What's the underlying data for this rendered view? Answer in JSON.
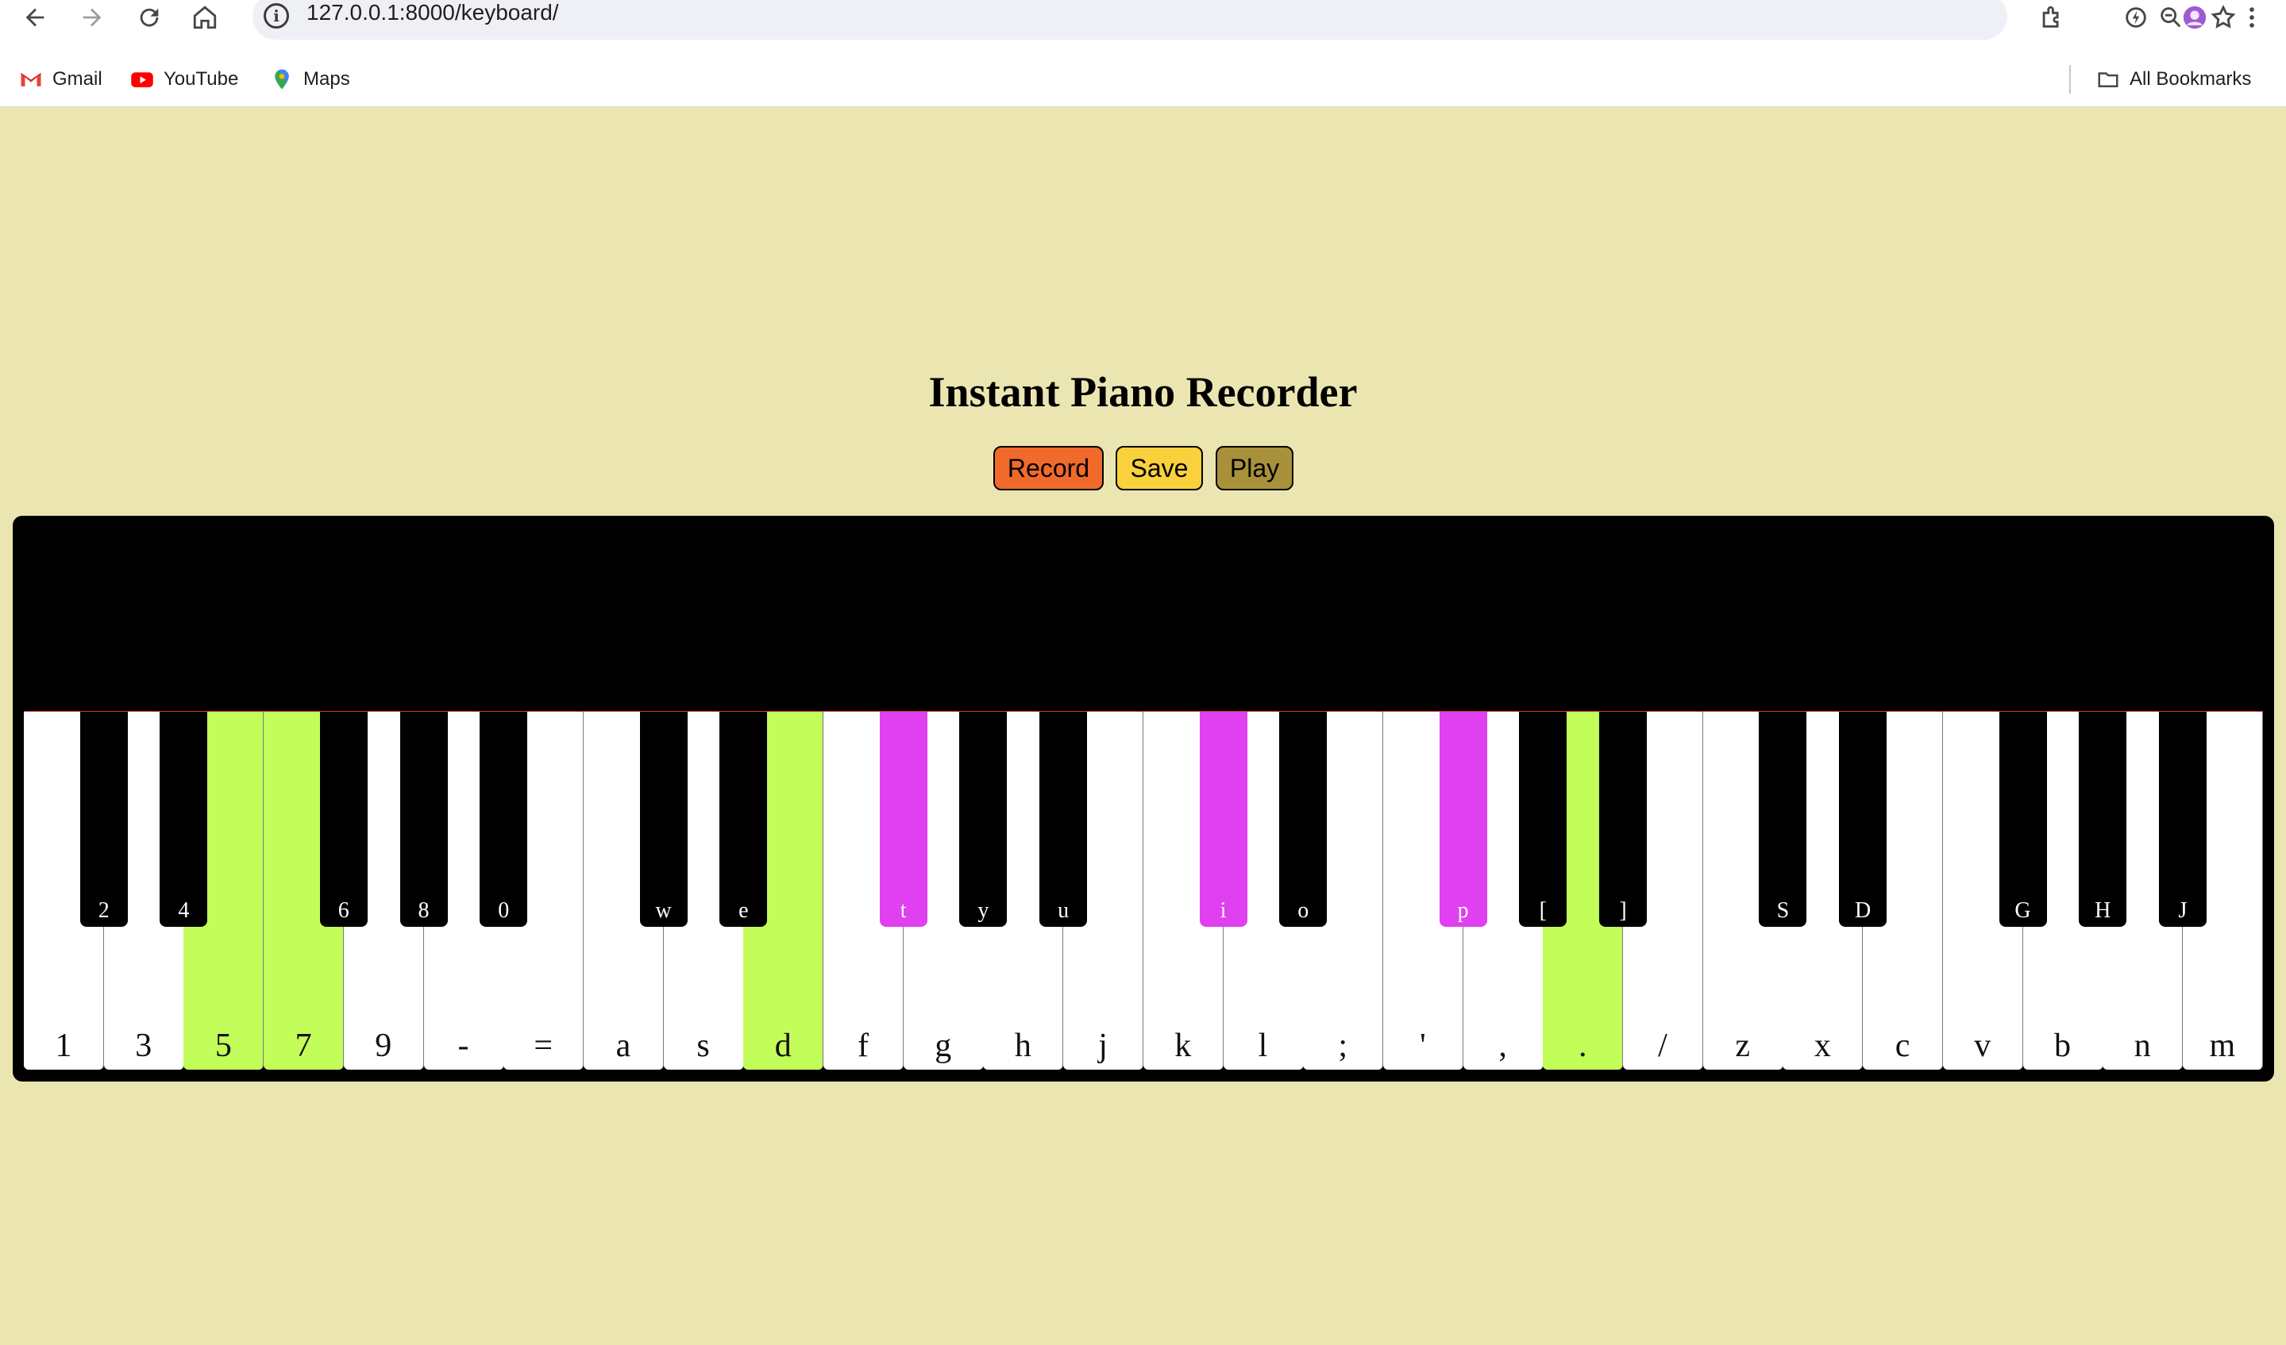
{
  "browser": {
    "url": "127.0.0.1:8000/keyboard/",
    "bookmarks": [
      "Gmail",
      "YouTube",
      "Maps"
    ],
    "all_bookmarks": "All Bookmarks"
  },
  "page": {
    "title": "Instant Piano Recorder",
    "buttons": {
      "record": "Record",
      "save": "Save",
      "play": "Play"
    }
  },
  "colors": {
    "background": "#EBE6B1",
    "record": "#F06A2B",
    "save": "#F8D13D",
    "play": "#A8913A",
    "active_white": "#C2FD5A",
    "active_black": "#E040F0"
  },
  "piano": {
    "white_keys": [
      {
        "label": "1",
        "active": false
      },
      {
        "label": "3",
        "active": false
      },
      {
        "label": "5",
        "active": true
      },
      {
        "label": "7",
        "active": true
      },
      {
        "label": "9",
        "active": false
      },
      {
        "label": "-",
        "active": false
      },
      {
        "label": "=",
        "active": false
      },
      {
        "label": "a",
        "active": false
      },
      {
        "label": "s",
        "active": false
      },
      {
        "label": "d",
        "active": true
      },
      {
        "label": "f",
        "active": false
      },
      {
        "label": "g",
        "active": false
      },
      {
        "label": "h",
        "active": false
      },
      {
        "label": "j",
        "active": false
      },
      {
        "label": "k",
        "active": false
      },
      {
        "label": "l",
        "active": false
      },
      {
        "label": ";",
        "active": false
      },
      {
        "label": "'",
        "active": false
      },
      {
        "label": ",",
        "active": false
      },
      {
        "label": ".",
        "active": true
      },
      {
        "label": "/",
        "active": false
      },
      {
        "label": "z",
        "active": false
      },
      {
        "label": "x",
        "active": false
      },
      {
        "label": "c",
        "active": false
      },
      {
        "label": "v",
        "active": false
      },
      {
        "label": "b",
        "active": false
      },
      {
        "label": "n",
        "active": false
      },
      {
        "label": "m",
        "active": false
      }
    ],
    "black_keys": [
      {
        "label": "2",
        "after": 0,
        "active": false
      },
      {
        "label": "4",
        "after": 1,
        "active": false
      },
      {
        "label": "6",
        "after": 3,
        "active": false
      },
      {
        "label": "8",
        "after": 4,
        "active": false
      },
      {
        "label": "0",
        "after": 5,
        "active": false
      },
      {
        "label": "w",
        "after": 7,
        "active": false
      },
      {
        "label": "e",
        "after": 8,
        "active": false
      },
      {
        "label": "t",
        "after": 10,
        "active": true
      },
      {
        "label": "y",
        "after": 11,
        "active": false
      },
      {
        "label": "u",
        "after": 12,
        "active": false
      },
      {
        "label": "i",
        "after": 14,
        "active": true
      },
      {
        "label": "o",
        "after": 15,
        "active": false
      },
      {
        "label": "p",
        "after": 17,
        "active": true
      },
      {
        "label": "[",
        "after": 18,
        "active": false
      },
      {
        "label": "]",
        "after": 19,
        "active": false
      },
      {
        "label": "S",
        "after": 21,
        "active": false
      },
      {
        "label": "D",
        "after": 22,
        "active": false
      },
      {
        "label": "G",
        "after": 24,
        "active": false
      },
      {
        "label": "H",
        "after": 25,
        "active": false
      },
      {
        "label": "J",
        "after": 26,
        "active": false
      }
    ]
  }
}
